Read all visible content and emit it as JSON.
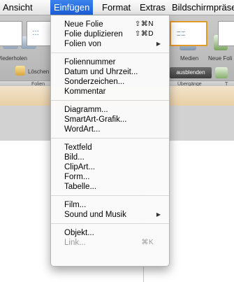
{
  "menubar": {
    "items": [
      "Ansicht",
      "Einfügen",
      "Format",
      "Extras",
      "Bildschirmpräse"
    ],
    "active_index": 1,
    "accent": "#2a6fe0"
  },
  "ribbon": {
    "labels": {
      "undo": "Wiederholen",
      "clear": "Löschen",
      "slides_group": "Folien",
      "media": "Medien",
      "new_slide": "Neue Foli",
      "hide": "ausblenden",
      "transitions_group": "Übergänge",
      "t": "T"
    }
  },
  "menu": {
    "groups": [
      [
        {
          "label": "Neue Folie",
          "shortcut": "⇧⌘N",
          "submenu": false,
          "enabled": true
        },
        {
          "label": "Folie duplizieren",
          "shortcut": "⇧⌘D",
          "submenu": false,
          "enabled": true
        },
        {
          "label": "Folien von",
          "shortcut": "",
          "submenu": true,
          "enabled": true
        }
      ],
      [
        {
          "label": "Foliennummer",
          "shortcut": "",
          "submenu": false,
          "enabled": true
        },
        {
          "label": "Datum und Uhrzeit...",
          "shortcut": "",
          "submenu": false,
          "enabled": true
        },
        {
          "label": "Sonderzeichen...",
          "shortcut": "",
          "submenu": false,
          "enabled": true
        },
        {
          "label": "Kommentar",
          "shortcut": "",
          "submenu": false,
          "enabled": true
        }
      ],
      [
        {
          "label": "Diagramm...",
          "shortcut": "",
          "submenu": false,
          "enabled": true
        },
        {
          "label": "SmartArt-Grafik...",
          "shortcut": "",
          "submenu": false,
          "enabled": true
        },
        {
          "label": "WordArt...",
          "shortcut": "",
          "submenu": false,
          "enabled": true
        }
      ],
      [
        {
          "label": "Textfeld",
          "shortcut": "",
          "submenu": false,
          "enabled": true
        },
        {
          "label": "Bild...",
          "shortcut": "",
          "submenu": false,
          "enabled": true
        },
        {
          "label": "ClipArt...",
          "shortcut": "",
          "submenu": false,
          "enabled": true
        },
        {
          "label": "Form...",
          "shortcut": "",
          "submenu": false,
          "enabled": true
        },
        {
          "label": "Tabelle...",
          "shortcut": "",
          "submenu": false,
          "enabled": true
        }
      ],
      [
        {
          "label": "Film...",
          "shortcut": "",
          "submenu": false,
          "enabled": true
        },
        {
          "label": "Sound und Musik",
          "shortcut": "",
          "submenu": true,
          "enabled": true
        }
      ],
      [
        {
          "label": "Objekt...",
          "shortcut": "",
          "submenu": false,
          "enabled": true
        },
        {
          "label": "Link...",
          "shortcut": "⌘K",
          "submenu": false,
          "enabled": false
        }
      ]
    ],
    "submenu_arrow": "▶"
  }
}
